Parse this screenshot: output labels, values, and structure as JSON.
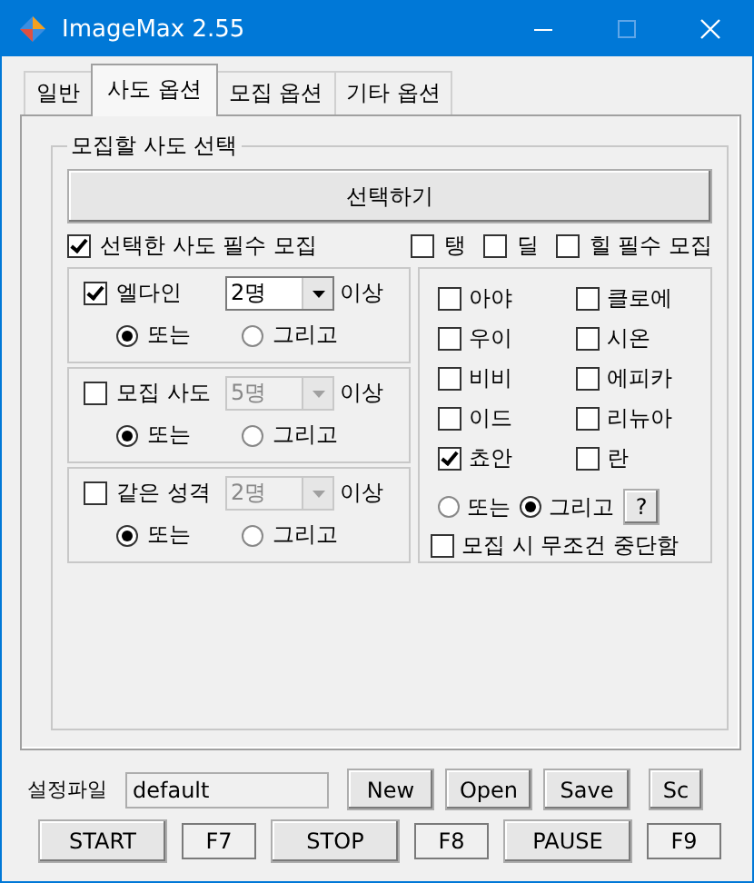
{
  "window": {
    "title": "ImageMax 2.55"
  },
  "tabs": [
    {
      "label": "일반",
      "selected": false
    },
    {
      "label": "사도 옵션",
      "selected": true
    },
    {
      "label": "모집 옵션",
      "selected": false
    },
    {
      "label": "기타 옵션",
      "selected": false
    }
  ],
  "group": {
    "title": "모집할 사도 선택",
    "select_button": "선택하기",
    "required": {
      "label": "선택한 사도 필수 모집",
      "checked": true
    },
    "role_checks": [
      {
        "label": "탱",
        "checked": false
      },
      {
        "label": "딜",
        "checked": false
      },
      {
        "label": "힐 필수 모집",
        "checked": false
      }
    ],
    "conditions": [
      {
        "label": "엘다인",
        "checked": true,
        "count": "2명",
        "disabled": false,
        "suffix": "이상",
        "options": [
          {
            "label": "또는",
            "selected": true
          },
          {
            "label": "그리고",
            "selected": false
          }
        ]
      },
      {
        "label": "모집 사도",
        "checked": false,
        "count": "5명",
        "disabled": true,
        "suffix": "이상",
        "options": [
          {
            "label": "또는",
            "selected": true
          },
          {
            "label": "그리고",
            "selected": false
          }
        ]
      },
      {
        "label": "같은 성격",
        "checked": false,
        "count": "2명",
        "disabled": true,
        "suffix": "이상",
        "options": [
          {
            "label": "또는",
            "selected": true
          },
          {
            "label": "그리고",
            "selected": false
          }
        ]
      }
    ],
    "characters": [
      {
        "label": "아야",
        "checked": false
      },
      {
        "label": "클로에",
        "checked": false
      },
      {
        "label": "우이",
        "checked": false
      },
      {
        "label": "시온",
        "checked": false
      },
      {
        "label": "비비",
        "checked": false
      },
      {
        "label": "에피카",
        "checked": false
      },
      {
        "label": "이드",
        "checked": false
      },
      {
        "label": "리뉴아",
        "checked": false
      },
      {
        "label": "쵸안",
        "checked": true
      },
      {
        "label": "란",
        "checked": false
      }
    ],
    "logic": [
      {
        "label": "또는",
        "selected": false
      },
      {
        "label": "그리고",
        "selected": true
      }
    ],
    "help_button": "?",
    "stop_check": {
      "label": "모집 시 무조건 중단함",
      "checked": false
    }
  },
  "config": {
    "label": "설정파일",
    "value": "default",
    "buttons": [
      "New",
      "Open",
      "Save",
      "Sc"
    ]
  },
  "controls": [
    {
      "label": "START",
      "kind": "button"
    },
    {
      "label": "F7",
      "kind": "hotkey"
    },
    {
      "label": "STOP",
      "kind": "button"
    },
    {
      "label": "F8",
      "kind": "hotkey"
    },
    {
      "label": "PAUSE",
      "kind": "button"
    },
    {
      "label": "F9",
      "kind": "hotkey"
    }
  ]
}
